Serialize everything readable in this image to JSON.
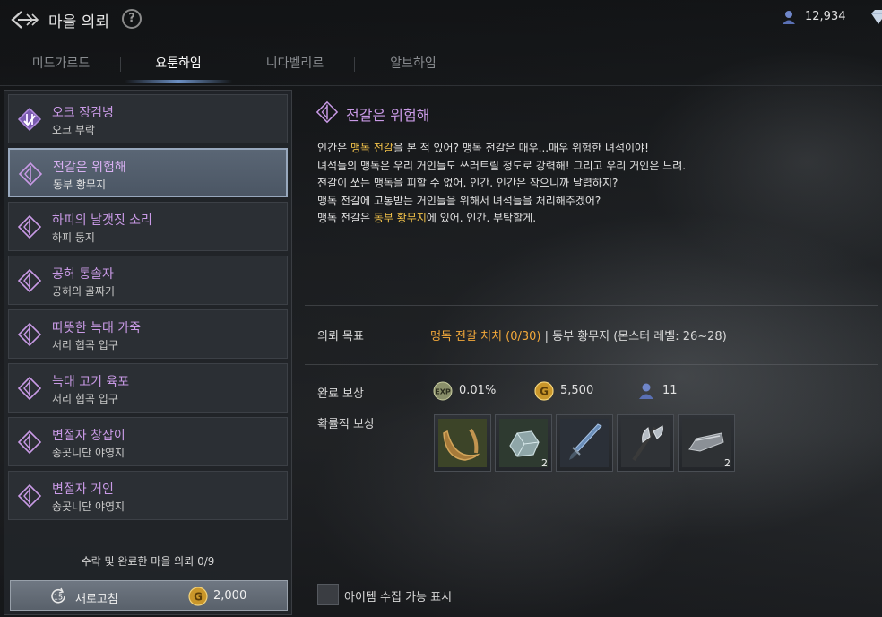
{
  "header": {
    "title": "마을 의뢰",
    "help_label": "?",
    "reputation": "12,934"
  },
  "tabs": [
    {
      "label": "미드가르드",
      "active": false
    },
    {
      "label": "요툰하임",
      "active": true
    },
    {
      "label": "니다벨리르",
      "active": false
    },
    {
      "label": "알브하임",
      "active": false
    }
  ],
  "quests": [
    {
      "title": "오크 장검병",
      "location": "오크 부락",
      "icon": "completed-quest-icon",
      "selected": false
    },
    {
      "title": "전갈은 위험해",
      "location": "동부 황무지",
      "icon": "quest-icon",
      "selected": true
    },
    {
      "title": "하피의 날갯짓 소리",
      "location": "하피 둥지",
      "icon": "quest-icon",
      "selected": false
    },
    {
      "title": "공허 통솔자",
      "location": "공허의 골짜기",
      "icon": "quest-icon",
      "selected": false
    },
    {
      "title": "따뜻한 늑대 가죽",
      "location": "서리 협곡 입구",
      "icon": "quest-icon",
      "selected": false
    },
    {
      "title": "늑대 고기 육포",
      "location": "서리 협곡 입구",
      "icon": "quest-icon",
      "selected": false
    },
    {
      "title": "변절자 창잡이",
      "location": "송곳니단 야영지",
      "icon": "quest-icon",
      "selected": false
    },
    {
      "title": "변절자 거인",
      "location": "송곳니단 야영지",
      "icon": "quest-icon",
      "selected": false
    }
  ],
  "footer": {
    "accepted_text": "수락 및 완료한 마을 의뢰 0/9",
    "refresh_count": "15",
    "refresh_label": "새로고침",
    "refresh_cost": "2,000"
  },
  "detail": {
    "title": "전갈은 위험해",
    "description": [
      {
        "pre": "인간은 ",
        "hl": "맹독 전갈",
        "post": "을 본 적 있어? 맹독 전갈은 매우...매우 위험한 녀석이야!"
      },
      {
        "pre": "녀석들의 맹독은 우리 거인들도 쓰러트릴 정도로 강력해! 그리고 우리 거인은 느려.",
        "hl": "",
        "post": ""
      },
      {
        "pre": "전갈이 쏘는 맹독을 피할 수 없어. 인간. 인간은 작으니까 날렵하지?",
        "hl": "",
        "post": ""
      },
      {
        "pre": "맹독 전갈에 고통받는 거인들을 위해서 녀석들을 처리해주겠어?",
        "hl": "",
        "post": ""
      },
      {
        "pre": "맹독 전갈은 ",
        "hl": "동부 황무지",
        "post": "에 있어. 인간. 부탁할게."
      }
    ],
    "objective_label": "의뢰 목표",
    "objective_main": "맹독 전갈 처치 (0/30)",
    "objective_rest": " | 동부 황무지  (몬스터 레벨: 26~28)",
    "reward_label": "완료 보상",
    "rewards": [
      {
        "icon": "exp-icon",
        "value": "0.01%"
      },
      {
        "icon": "gold-icon",
        "value": "5,500"
      },
      {
        "icon": "reputation-icon",
        "value": "11"
      }
    ],
    "chance_reward_label": "확률적 보상",
    "items": [
      {
        "name": "horn-item",
        "count": ""
      },
      {
        "name": "ore-item",
        "count": "2"
      },
      {
        "name": "dagger-item",
        "count": ""
      },
      {
        "name": "axe-item",
        "count": ""
      },
      {
        "name": "scrap-item",
        "count": "2"
      }
    ],
    "checkbox_label": "아이템 수집 가능 표시"
  }
}
